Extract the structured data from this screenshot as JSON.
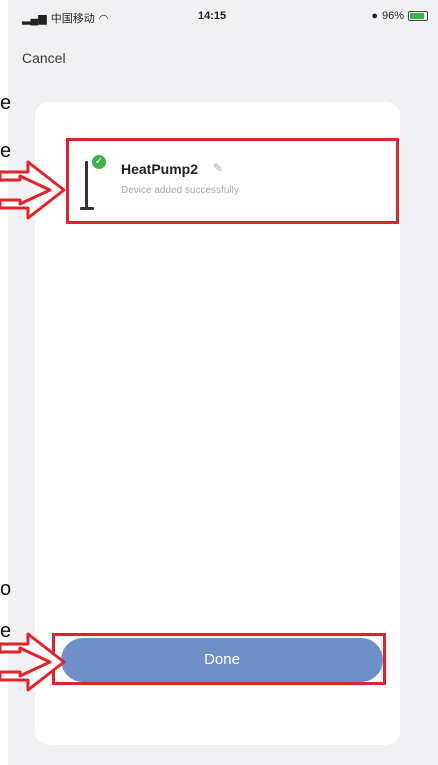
{
  "status_bar": {
    "carrier": "中国移动",
    "time": "14:15",
    "battery": "96%"
  },
  "header": {
    "cancel_label": "Cancel"
  },
  "device": {
    "name": "HeatPump2",
    "status": "Device added successfully"
  },
  "footer": {
    "done_label": "Done"
  },
  "side_text": [
    "e",
    "e",
    "o",
    "e"
  ],
  "colors": {
    "accent": "#6f8fc8",
    "highlight": "#e3232b",
    "success": "#3bb34a"
  }
}
